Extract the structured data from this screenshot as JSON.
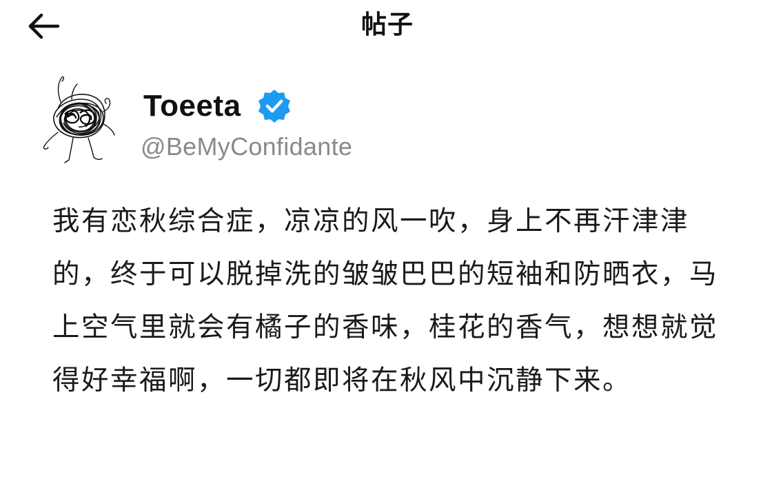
{
  "header": {
    "back_icon": "arrow-left-icon",
    "title": "帖子"
  },
  "author": {
    "display_name": "Toeeta",
    "verified": true,
    "verified_icon": "verified-badge-icon",
    "verified_color": "#1d9bf0",
    "handle": "@BeMyConfidante",
    "avatar_icon": "scribble-avatar-icon"
  },
  "post": {
    "text": "我有恋秋综合症，凉凉的风一吹，身上不再汗津津的，终于可以脱掉洗的皱皱巴巴的短袖和防晒衣，马上空气里就会有橘子的香味，桂花的香气，想想就觉得好幸福啊，一切都即将在秋风中沉静下来。"
  }
}
